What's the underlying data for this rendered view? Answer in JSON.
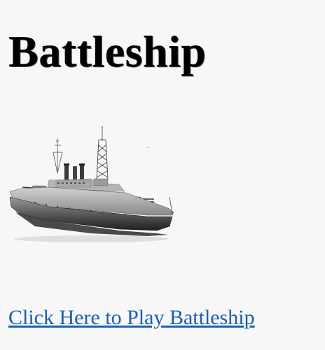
{
  "page": {
    "title": "Battleship",
    "link_text": "Click Here to Play Battleship"
  },
  "image": {
    "subject": "battleship-image"
  },
  "colors": {
    "background": "#f7f7f7",
    "link": "#1a5fb4",
    "title": "#000000"
  }
}
